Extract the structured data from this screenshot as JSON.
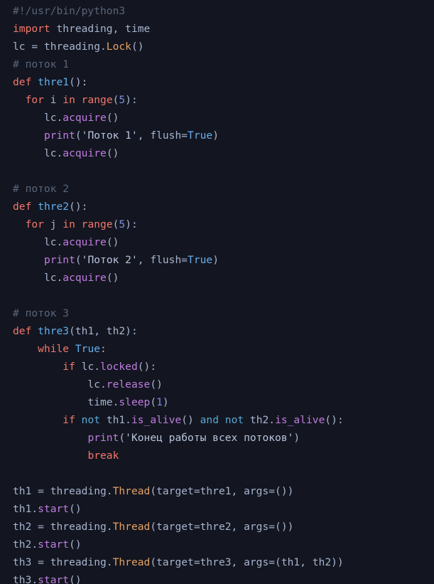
{
  "editor": {
    "language": "python",
    "background": "#131620",
    "default_text_color": "#a7b4cf",
    "font_size_px": 14.6,
    "line_height_px": 25,
    "total_lines": 33,
    "palette": {
      "comment": "#59647a",
      "keyword": "#f4766b",
      "function_name": "#61afef",
      "class_name": "#e5a065",
      "method": "#c07ce0",
      "builtin_constant": "#64aef0",
      "logic_operator": "#56a8d8",
      "number": "#7b8fe8",
      "string": "#b8c4de",
      "identifier": "#a7b4cf"
    }
  },
  "code": {
    "plain_text": "#!/usr/bin/python3\nimport threading, time\nlc = threading.Lock()\n# поток 1\ndef thre1():\n  for i in range(5):\n     lc.acquire()\n     print('Поток 1', flush=True)\n     lc.acquire()\n\n# поток 2\ndef thre2():\n  for j in range(5):\n     lc.acquire()\n     print('Поток 2', flush=True)\n     lc.acquire()\n\n# поток 3\ndef thre3(th1, th2):\n    while True:\n        if lc.locked():\n            lc.release()\n            time.sleep(1)\n        if not th1.is_alive() and not th2.is_alive():\n            print('Конец работы всех потоков')\n            break\n\nth1 = threading.Thread(target=thre1, args=())\nth1.start()\nth2 = threading.Thread(target=thre2, args=())\nth2.start()\nth3 = threading.Thread(target=thre3, args=(th1, th2))\nth3.start()",
    "lines": [
      {
        "n": 1,
        "tokens": [
          {
            "t": "#!/usr/bin/python3",
            "c": "com"
          }
        ]
      },
      {
        "n": 2,
        "tokens": [
          {
            "t": "import",
            "c": "kw"
          },
          {
            "t": " threading, time",
            "c": "var"
          }
        ]
      },
      {
        "n": 3,
        "tokens": [
          {
            "t": "lc = threading.",
            "c": "var"
          },
          {
            "t": "Lock",
            "c": "cls"
          },
          {
            "t": "()",
            "c": "var"
          }
        ]
      },
      {
        "n": 4,
        "tokens": [
          {
            "t": "# поток 1",
            "c": "com"
          }
        ]
      },
      {
        "n": 5,
        "tokens": [
          {
            "t": "def",
            "c": "kw"
          },
          {
            "t": " ",
            "c": "var"
          },
          {
            "t": "thre1",
            "c": "fn"
          },
          {
            "t": "():",
            "c": "var"
          }
        ]
      },
      {
        "n": 6,
        "tokens": [
          {
            "t": "  ",
            "c": "var"
          },
          {
            "t": "for",
            "c": "kw"
          },
          {
            "t": " i ",
            "c": "var"
          },
          {
            "t": "in",
            "c": "kw"
          },
          {
            "t": " ",
            "c": "var"
          },
          {
            "t": "range",
            "c": "kw"
          },
          {
            "t": "(",
            "c": "var"
          },
          {
            "t": "5",
            "c": "num"
          },
          {
            "t": "):",
            "c": "var"
          }
        ]
      },
      {
        "n": 7,
        "tokens": [
          {
            "t": "     lc.",
            "c": "var"
          },
          {
            "t": "acquire",
            "c": "met"
          },
          {
            "t": "()",
            "c": "var"
          }
        ]
      },
      {
        "n": 8,
        "tokens": [
          {
            "t": "     ",
            "c": "var"
          },
          {
            "t": "print",
            "c": "met"
          },
          {
            "t": "(",
            "c": "var"
          },
          {
            "t": "'Поток 1'",
            "c": "str"
          },
          {
            "t": ", flush=",
            "c": "var"
          },
          {
            "t": "True",
            "c": "bi"
          },
          {
            "t": ")",
            "c": "var"
          }
        ]
      },
      {
        "n": 9,
        "tokens": [
          {
            "t": "     lc.",
            "c": "var"
          },
          {
            "t": "acquire",
            "c": "met"
          },
          {
            "t": "()",
            "c": "var"
          }
        ]
      },
      {
        "n": 10,
        "tokens": []
      },
      {
        "n": 11,
        "tokens": [
          {
            "t": "# поток 2",
            "c": "com"
          }
        ]
      },
      {
        "n": 12,
        "tokens": [
          {
            "t": "def",
            "c": "kw"
          },
          {
            "t": " ",
            "c": "var"
          },
          {
            "t": "thre2",
            "c": "fn"
          },
          {
            "t": "():",
            "c": "var"
          }
        ]
      },
      {
        "n": 13,
        "tokens": [
          {
            "t": "  ",
            "c": "var"
          },
          {
            "t": "for",
            "c": "kw"
          },
          {
            "t": " j ",
            "c": "var"
          },
          {
            "t": "in",
            "c": "kw"
          },
          {
            "t": " ",
            "c": "var"
          },
          {
            "t": "range",
            "c": "kw"
          },
          {
            "t": "(",
            "c": "var"
          },
          {
            "t": "5",
            "c": "num"
          },
          {
            "t": "):",
            "c": "var"
          }
        ]
      },
      {
        "n": 14,
        "tokens": [
          {
            "t": "     lc.",
            "c": "var"
          },
          {
            "t": "acquire",
            "c": "met"
          },
          {
            "t": "()",
            "c": "var"
          }
        ]
      },
      {
        "n": 15,
        "tokens": [
          {
            "t": "     ",
            "c": "var"
          },
          {
            "t": "print",
            "c": "met"
          },
          {
            "t": "(",
            "c": "var"
          },
          {
            "t": "'Поток 2'",
            "c": "str"
          },
          {
            "t": ", flush=",
            "c": "var"
          },
          {
            "t": "True",
            "c": "bi"
          },
          {
            "t": ")",
            "c": "var"
          }
        ]
      },
      {
        "n": 16,
        "tokens": [
          {
            "t": "     lc.",
            "c": "var"
          },
          {
            "t": "acquire",
            "c": "met"
          },
          {
            "t": "()",
            "c": "var"
          }
        ]
      },
      {
        "n": 17,
        "tokens": []
      },
      {
        "n": 18,
        "tokens": [
          {
            "t": "# поток 3",
            "c": "com"
          }
        ]
      },
      {
        "n": 19,
        "tokens": [
          {
            "t": "def",
            "c": "kw"
          },
          {
            "t": " ",
            "c": "var"
          },
          {
            "t": "thre3",
            "c": "fn"
          },
          {
            "t": "(th1, th2):",
            "c": "var"
          }
        ]
      },
      {
        "n": 20,
        "tokens": [
          {
            "t": "    ",
            "c": "var"
          },
          {
            "t": "while",
            "c": "kw"
          },
          {
            "t": " ",
            "c": "var"
          },
          {
            "t": "True",
            "c": "bi"
          },
          {
            "t": ":",
            "c": "var"
          }
        ]
      },
      {
        "n": 21,
        "tokens": [
          {
            "t": "        ",
            "c": "var"
          },
          {
            "t": "if",
            "c": "kw"
          },
          {
            "t": " lc.",
            "c": "var"
          },
          {
            "t": "locked",
            "c": "met"
          },
          {
            "t": "():",
            "c": "var"
          }
        ]
      },
      {
        "n": 22,
        "tokens": [
          {
            "t": "            lc.",
            "c": "var"
          },
          {
            "t": "release",
            "c": "met"
          },
          {
            "t": "()",
            "c": "var"
          }
        ]
      },
      {
        "n": 23,
        "tokens": [
          {
            "t": "            time.",
            "c": "var"
          },
          {
            "t": "sleep",
            "c": "met"
          },
          {
            "t": "(",
            "c": "var"
          },
          {
            "t": "1",
            "c": "num"
          },
          {
            "t": ")",
            "c": "var"
          }
        ]
      },
      {
        "n": 24,
        "tokens": [
          {
            "t": "        ",
            "c": "var"
          },
          {
            "t": "if",
            "c": "kw"
          },
          {
            "t": " ",
            "c": "var"
          },
          {
            "t": "not",
            "c": "op2"
          },
          {
            "t": " th1.",
            "c": "var"
          },
          {
            "t": "is_alive",
            "c": "met"
          },
          {
            "t": "() ",
            "c": "var"
          },
          {
            "t": "and",
            "c": "op2"
          },
          {
            "t": " ",
            "c": "var"
          },
          {
            "t": "not",
            "c": "op2"
          },
          {
            "t": " th2.",
            "c": "var"
          },
          {
            "t": "is_alive",
            "c": "met"
          },
          {
            "t": "():",
            "c": "var"
          }
        ]
      },
      {
        "n": 25,
        "tokens": [
          {
            "t": "            ",
            "c": "var"
          },
          {
            "t": "print",
            "c": "met"
          },
          {
            "t": "(",
            "c": "var"
          },
          {
            "t": "'Конец работы всех потоков'",
            "c": "str"
          },
          {
            "t": ")",
            "c": "var"
          }
        ]
      },
      {
        "n": 26,
        "tokens": [
          {
            "t": "            ",
            "c": "var"
          },
          {
            "t": "break",
            "c": "kw"
          }
        ]
      },
      {
        "n": 27,
        "tokens": []
      },
      {
        "n": 28,
        "tokens": [
          {
            "t": "th1 = threading.",
            "c": "var"
          },
          {
            "t": "Thread",
            "c": "cls"
          },
          {
            "t": "(target=thre1, args=())",
            "c": "var"
          }
        ]
      },
      {
        "n": 29,
        "tokens": [
          {
            "t": "th1.",
            "c": "var"
          },
          {
            "t": "start",
            "c": "met"
          },
          {
            "t": "()",
            "c": "var"
          }
        ]
      },
      {
        "n": 30,
        "tokens": [
          {
            "t": "th2 = threading.",
            "c": "var"
          },
          {
            "t": "Thread",
            "c": "cls"
          },
          {
            "t": "(target=thre2, args=())",
            "c": "var"
          }
        ]
      },
      {
        "n": 31,
        "tokens": [
          {
            "t": "th2.",
            "c": "var"
          },
          {
            "t": "start",
            "c": "met"
          },
          {
            "t": "()",
            "c": "var"
          }
        ]
      },
      {
        "n": 32,
        "tokens": [
          {
            "t": "th3 = threading.",
            "c": "var"
          },
          {
            "t": "Thread",
            "c": "cls"
          },
          {
            "t": "(target=thre3, args=(th1, th2))",
            "c": "var"
          }
        ]
      },
      {
        "n": 33,
        "tokens": [
          {
            "t": "th3.",
            "c": "var"
          },
          {
            "t": "start",
            "c": "met"
          },
          {
            "t": "()",
            "c": "var"
          }
        ]
      }
    ]
  }
}
